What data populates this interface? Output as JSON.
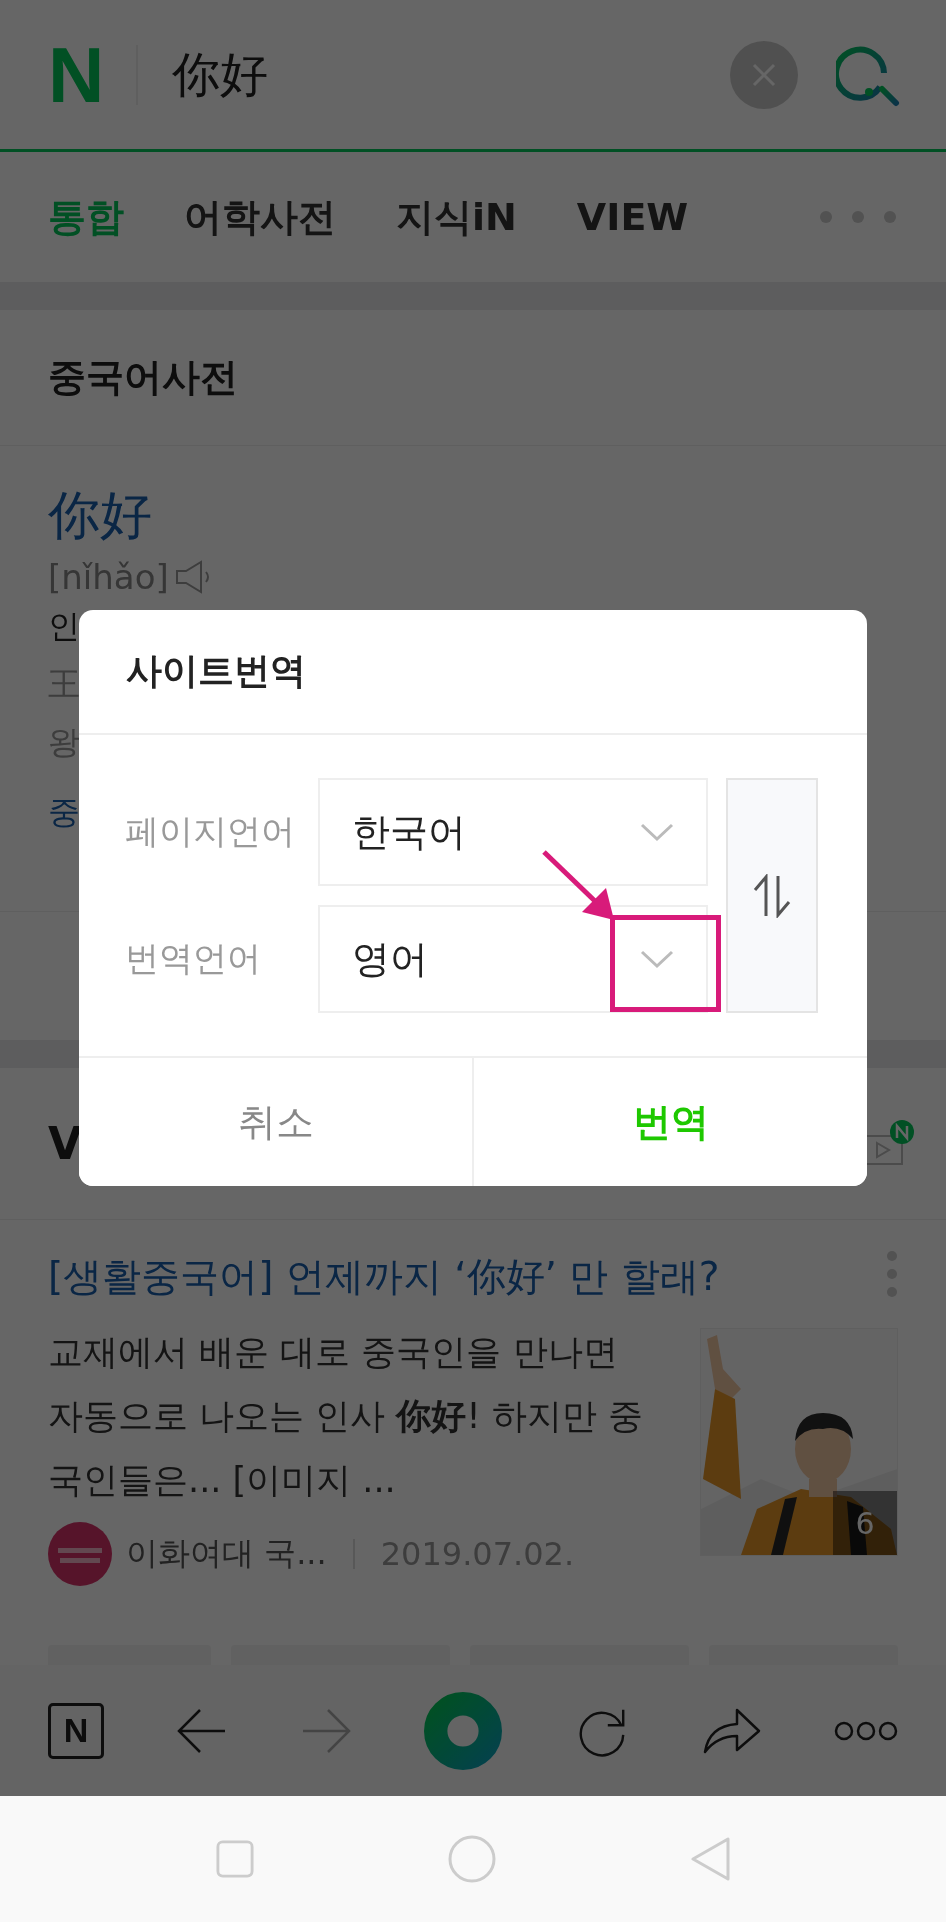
{
  "header": {
    "logo": "N",
    "query": "你好"
  },
  "tabs": [
    {
      "label": "통합",
      "selected": true
    },
    {
      "label": "어학사전",
      "selected": false
    },
    {
      "label": "지식iN",
      "selected": false
    },
    {
      "label": "VIEW",
      "selected": false
    }
  ],
  "dictionary": {
    "title": "중국어사전",
    "word": "你好",
    "pinyin": "[nǐhǎo]",
    "lines": [
      {
        "text": "인",
        "kind": "meaning"
      },
      {
        "text": "王",
        "kind": "example"
      },
      {
        "text": "왕",
        "kind": "example"
      },
      {
        "text": "중",
        "kind": "link"
      }
    ]
  },
  "view_section": {
    "title": "V",
    "article": {
      "title": "[생활중국어] 언제까지 ‘你好’ 만 할래?",
      "snippet": "교재에서 배운 대로 중국인을 만나면 자동으로 나오는 인사 **你好**! 하지만 중국인들은... [이미지 ...",
      "author": "이화여대 국...",
      "date": "2019.07.02.",
      "photo_count": "6"
    }
  },
  "toolbar": {
    "home_logo": "N",
    "forward_disabled": true
  },
  "dialog": {
    "title": "사이트번역",
    "rows": [
      {
        "label": "페이지언어",
        "value": "한국어",
        "highlighted": false
      },
      {
        "label": "번역언어",
        "value": "영어",
        "highlighted": true
      }
    ],
    "buttons": [
      {
        "label": "취소",
        "kind": "cancel"
      },
      {
        "label": "번역",
        "kind": "primary"
      }
    ]
  }
}
